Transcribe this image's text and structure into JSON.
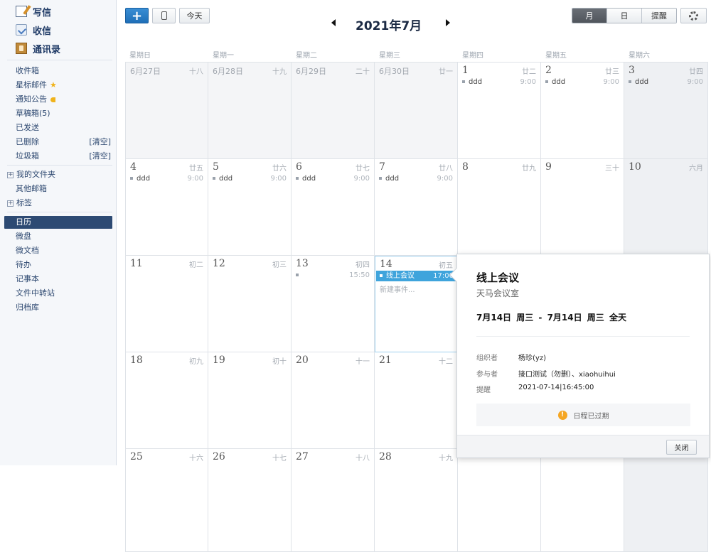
{
  "sidebar": {
    "top": [
      {
        "label": "写信",
        "icon": "compose-icon"
      },
      {
        "label": "收信",
        "icon": "inbox-icon"
      },
      {
        "label": "通讯录",
        "icon": "contacts-icon"
      }
    ],
    "folders": [
      {
        "label": "收件箱"
      },
      {
        "label": "星标邮件",
        "icon": "star-icon"
      },
      {
        "label": "通知公告",
        "icon": "announcement-icon"
      },
      {
        "label": "草稿箱(5)"
      },
      {
        "label": "已发送"
      },
      {
        "label": "已删除",
        "action": "[清空]"
      },
      {
        "label": "垃圾箱",
        "action": "[清空]"
      }
    ],
    "tree": [
      {
        "label": "我的文件夹",
        "toggle": "+"
      },
      {
        "label": "其他邮箱"
      },
      {
        "label": "标签",
        "toggle": "+"
      }
    ],
    "apps": [
      {
        "label": "日历",
        "active": true
      },
      {
        "label": "微盘"
      },
      {
        "label": "微文档"
      },
      {
        "label": "待办"
      },
      {
        "label": "记事本"
      },
      {
        "label": "文件中转站"
      },
      {
        "label": "归档库"
      }
    ]
  },
  "toolbar": {
    "add": "+",
    "today": "今天",
    "month_title": "2021年7月",
    "views": [
      {
        "label": "月",
        "active": true
      },
      {
        "label": "日",
        "active": false
      },
      {
        "label": "提醒",
        "active": false
      }
    ]
  },
  "weekdays": [
    "星期日",
    "星期一",
    "星期二",
    "星期三",
    "星期四",
    "星期五",
    "星期六"
  ],
  "weeks": [
    [
      {
        "day": "6月27日",
        "lunar": "十八",
        "other": true
      },
      {
        "day": "6月28日",
        "lunar": "十九",
        "other": true
      },
      {
        "day": "6月29日",
        "lunar": "二十",
        "other": true
      },
      {
        "day": "6月30日",
        "lunar": "廿一",
        "other": true
      },
      {
        "day": "1",
        "lunar": "廿二",
        "event": {
          "title": "ddd",
          "time": "9:00"
        }
      },
      {
        "day": "2",
        "lunar": "廿三",
        "event": {
          "title": "ddd",
          "time": "9:00"
        }
      },
      {
        "day": "3",
        "lunar": "廿四",
        "sat": true,
        "event": {
          "title": "ddd",
          "time": "9:00"
        }
      }
    ],
    [
      {
        "day": "4",
        "lunar": "廿五",
        "event": {
          "title": "ddd",
          "time": "9:00"
        }
      },
      {
        "day": "5",
        "lunar": "廿六",
        "event": {
          "title": "ddd",
          "time": "9:00"
        }
      },
      {
        "day": "6",
        "lunar": "廿七",
        "event": {
          "title": "ddd",
          "time": "9:00"
        }
      },
      {
        "day": "7",
        "lunar": "廿八",
        "event": {
          "title": "ddd",
          "time": "9:00"
        }
      },
      {
        "day": "8",
        "lunar": "廿九"
      },
      {
        "day": "9",
        "lunar": "三十"
      },
      {
        "day": "10",
        "lunar": "六月",
        "sat": true
      }
    ],
    [
      {
        "day": "11",
        "lunar": "初二"
      },
      {
        "day": "12",
        "lunar": "初三"
      },
      {
        "day": "13",
        "lunar": "初四",
        "event": {
          "title": "",
          "time": "15:50"
        }
      },
      {
        "day": "14",
        "lunar": "初五",
        "today": true,
        "event": {
          "title": "线上会议",
          "time": "17:00",
          "highlight": true
        },
        "new_event": "新建事件..."
      },
      {
        "day": "",
        "lunar": ""
      },
      {
        "day": "",
        "lunar": ""
      },
      {
        "day": "",
        "lunar": "",
        "sat": true
      }
    ],
    [
      {
        "day": "18",
        "lunar": "初九"
      },
      {
        "day": "19",
        "lunar": "初十"
      },
      {
        "day": "20",
        "lunar": "十一"
      },
      {
        "day": "21",
        "lunar": "十二"
      },
      {
        "day": "",
        "lunar": ""
      },
      {
        "day": "",
        "lunar": ""
      },
      {
        "day": "",
        "lunar": "",
        "sat": true
      }
    ],
    [
      {
        "day": "25",
        "lunar": "十六"
      },
      {
        "day": "26",
        "lunar": "十七"
      },
      {
        "day": "27",
        "lunar": "十八"
      },
      {
        "day": "28",
        "lunar": "十九"
      },
      {
        "day": "",
        "lunar": ""
      },
      {
        "day": "",
        "lunar": ""
      },
      {
        "day": "",
        "lunar": "",
        "sat": true
      }
    ]
  ],
  "popup": {
    "title": "线上会议",
    "location": "天马会议室",
    "time_range": "7月14日 周三  -  7月14日 周三  全天",
    "organizer_label": "组织者",
    "organizer": "杨珍(yz)",
    "attendees_label": "参与者",
    "attendees": "接口测试（勿删）、xiaohuihui",
    "reminder_label": "提醒",
    "reminder": "2021-07-14|16:45:00",
    "status": "日程已过期",
    "close": "关闭"
  }
}
